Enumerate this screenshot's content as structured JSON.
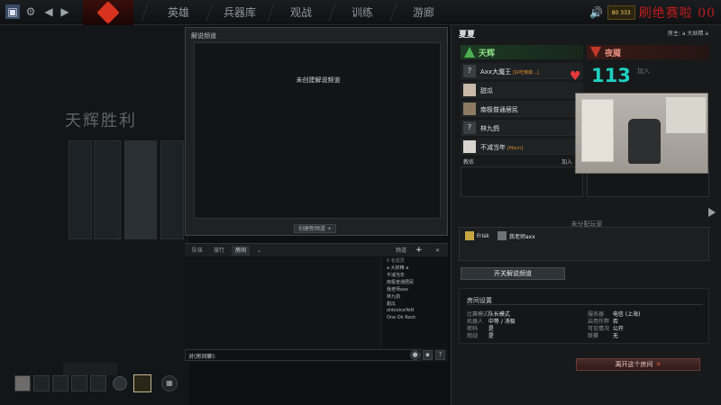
{
  "topbar": {
    "nav": [
      "英雄",
      "兵器库",
      "观战",
      "训练",
      "游廊"
    ],
    "badge_text": "80 333",
    "watermark": "刷绝赛啦 00"
  },
  "background": {
    "victory_text": "天辉胜利"
  },
  "channel": {
    "title": "解说频道",
    "empty_text": "未创建解说频道",
    "new_button": "创建新频道 +"
  },
  "chat": {
    "tabs": [
      "队伍",
      "旅行",
      "房间"
    ],
    "channel_label": "频道",
    "add": "+",
    "close": "✕",
    "users_header": "0 名成员",
    "users": [
      "a 大妖精 a",
      "不减当年",
      "南极普通居民",
      "我老师axx",
      "林九鸽",
      "甜瓜",
      "oldvoiceYeN",
      "One Ok Rock"
    ],
    "input_prefix": "对(房间聊):",
    "help": "?"
  },
  "lobby": {
    "name": "夏夏",
    "host": "房主: a 大妖精 a",
    "radiant": {
      "label": "天辉",
      "players": [
        {
          "avatar": "?",
          "name": "Axx大魔王",
          "tag": "[好吃懒做...]"
        },
        {
          "avatar": "",
          "name": "甜瓜",
          "tag": ""
        },
        {
          "avatar": "",
          "name": "南极普通居民",
          "tag": ""
        },
        {
          "avatar": "?",
          "name": "林九鸽",
          "tag": ""
        },
        {
          "avatar": "",
          "name": "不减当年",
          "tag": "[Macn]"
        }
      ]
    },
    "dire": {
      "label": "夜魇",
      "join_label": "加入"
    },
    "coach_label": "教练",
    "coach_join": "加入",
    "unassigned_title": "未分配玩家",
    "unassigned": [
      "Frisk",
      "我老师axx"
    ],
    "toggle_commentary": "开关解说频道",
    "settings": {
      "title": "房间设置",
      "left": [
        {
          "k": "比赛模式",
          "v": "队长模式"
        },
        {
          "k": "机器人",
          "v": "中等 / 消极"
        },
        {
          "k": "密码",
          "v": "是"
        },
        {
          "k": "观战",
          "v": "是"
        }
      ],
      "right": [
        {
          "k": "服务器",
          "v": "电信 (上海)"
        },
        {
          "k": "启用作弊",
          "v": "否"
        },
        {
          "k": "可见情况",
          "v": "公开"
        },
        {
          "k": "联赛",
          "v": "无"
        }
      ]
    },
    "leave_button": "离开这个房间"
  },
  "overlay": {
    "heart_rate": "113"
  }
}
